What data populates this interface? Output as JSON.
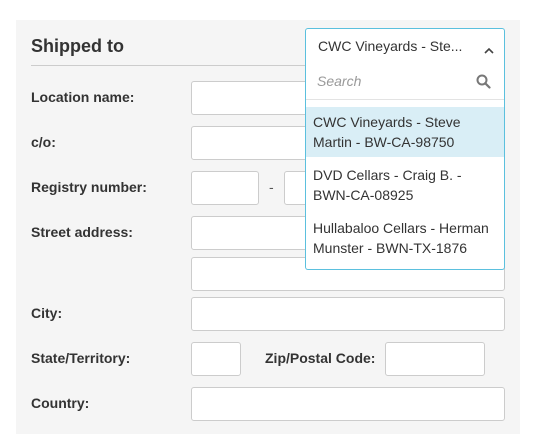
{
  "section": {
    "title": "Shipped to"
  },
  "form": {
    "location_name_label": "Location name:",
    "co_label": "c/o:",
    "registry_label": "Registry number:",
    "registry_separator": "-",
    "street_label": "Street address:",
    "city_label": "City:",
    "state_label": "State/Territory:",
    "zip_label": "Zip/Postal Code:",
    "country_label": "Country:"
  },
  "dropdown": {
    "selected_display": "CWC Vineyards - Ste...",
    "search_placeholder": "Search",
    "options": [
      {
        "label": "CWC Vineyards - Steve Martin - BW-CA-98750",
        "selected": true
      },
      {
        "label": "DVD Cellars - Craig B. - BWN-CA-08925",
        "selected": false
      },
      {
        "label": "Hullabaloo Cellars - Herman Munster - BWN-TX-1876",
        "selected": false
      }
    ]
  },
  "colors": {
    "accent_border": "#5bc0de",
    "selected_option_bg": "#d9eef6",
    "panel_bg": "#f5f5f5"
  },
  "icons": {
    "toggle": "chevron-up-icon",
    "search": "search-icon"
  }
}
